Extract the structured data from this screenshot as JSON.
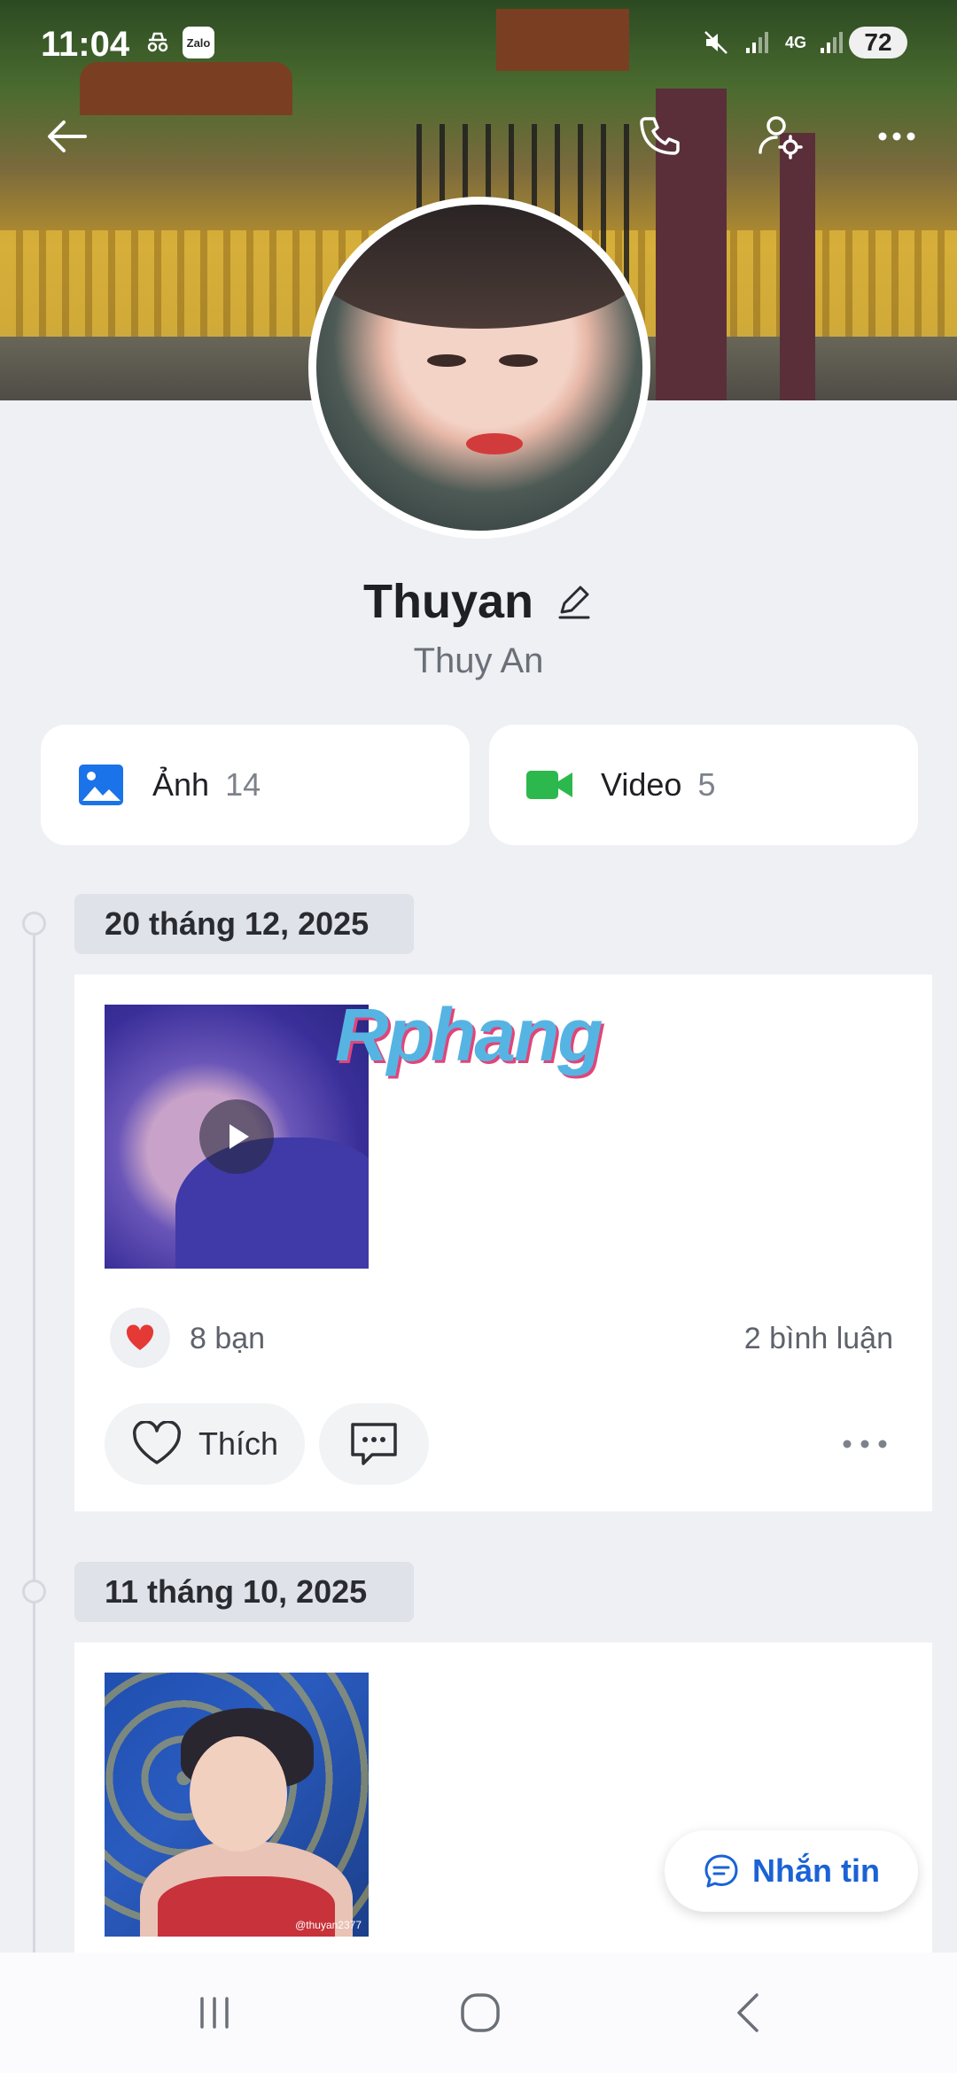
{
  "status_bar": {
    "time": "11:04",
    "app_badge": "Zalo",
    "network": "4G",
    "battery": "72"
  },
  "profile": {
    "display_name": "Thuyan",
    "real_name": "Thuy An"
  },
  "media": {
    "photos_label": "Ảnh",
    "photos_count": "14",
    "videos_label": "Video",
    "videos_count": "5"
  },
  "watermark": "Rphang",
  "posts": [
    {
      "date": "20 tháng 12, 2025",
      "reactions": "8 bạn",
      "comments": "2 bình luận",
      "like_label": "Thích",
      "is_video": true
    },
    {
      "date": "11 tháng 10, 2025",
      "thumb_tag": "@thuyan2377"
    }
  ],
  "message_button": "Nhắn tin",
  "colors": {
    "accent": "#1a62d6",
    "photo_icon": "#1a73e8",
    "video_icon": "#2db84d",
    "heart": "#e53935"
  }
}
